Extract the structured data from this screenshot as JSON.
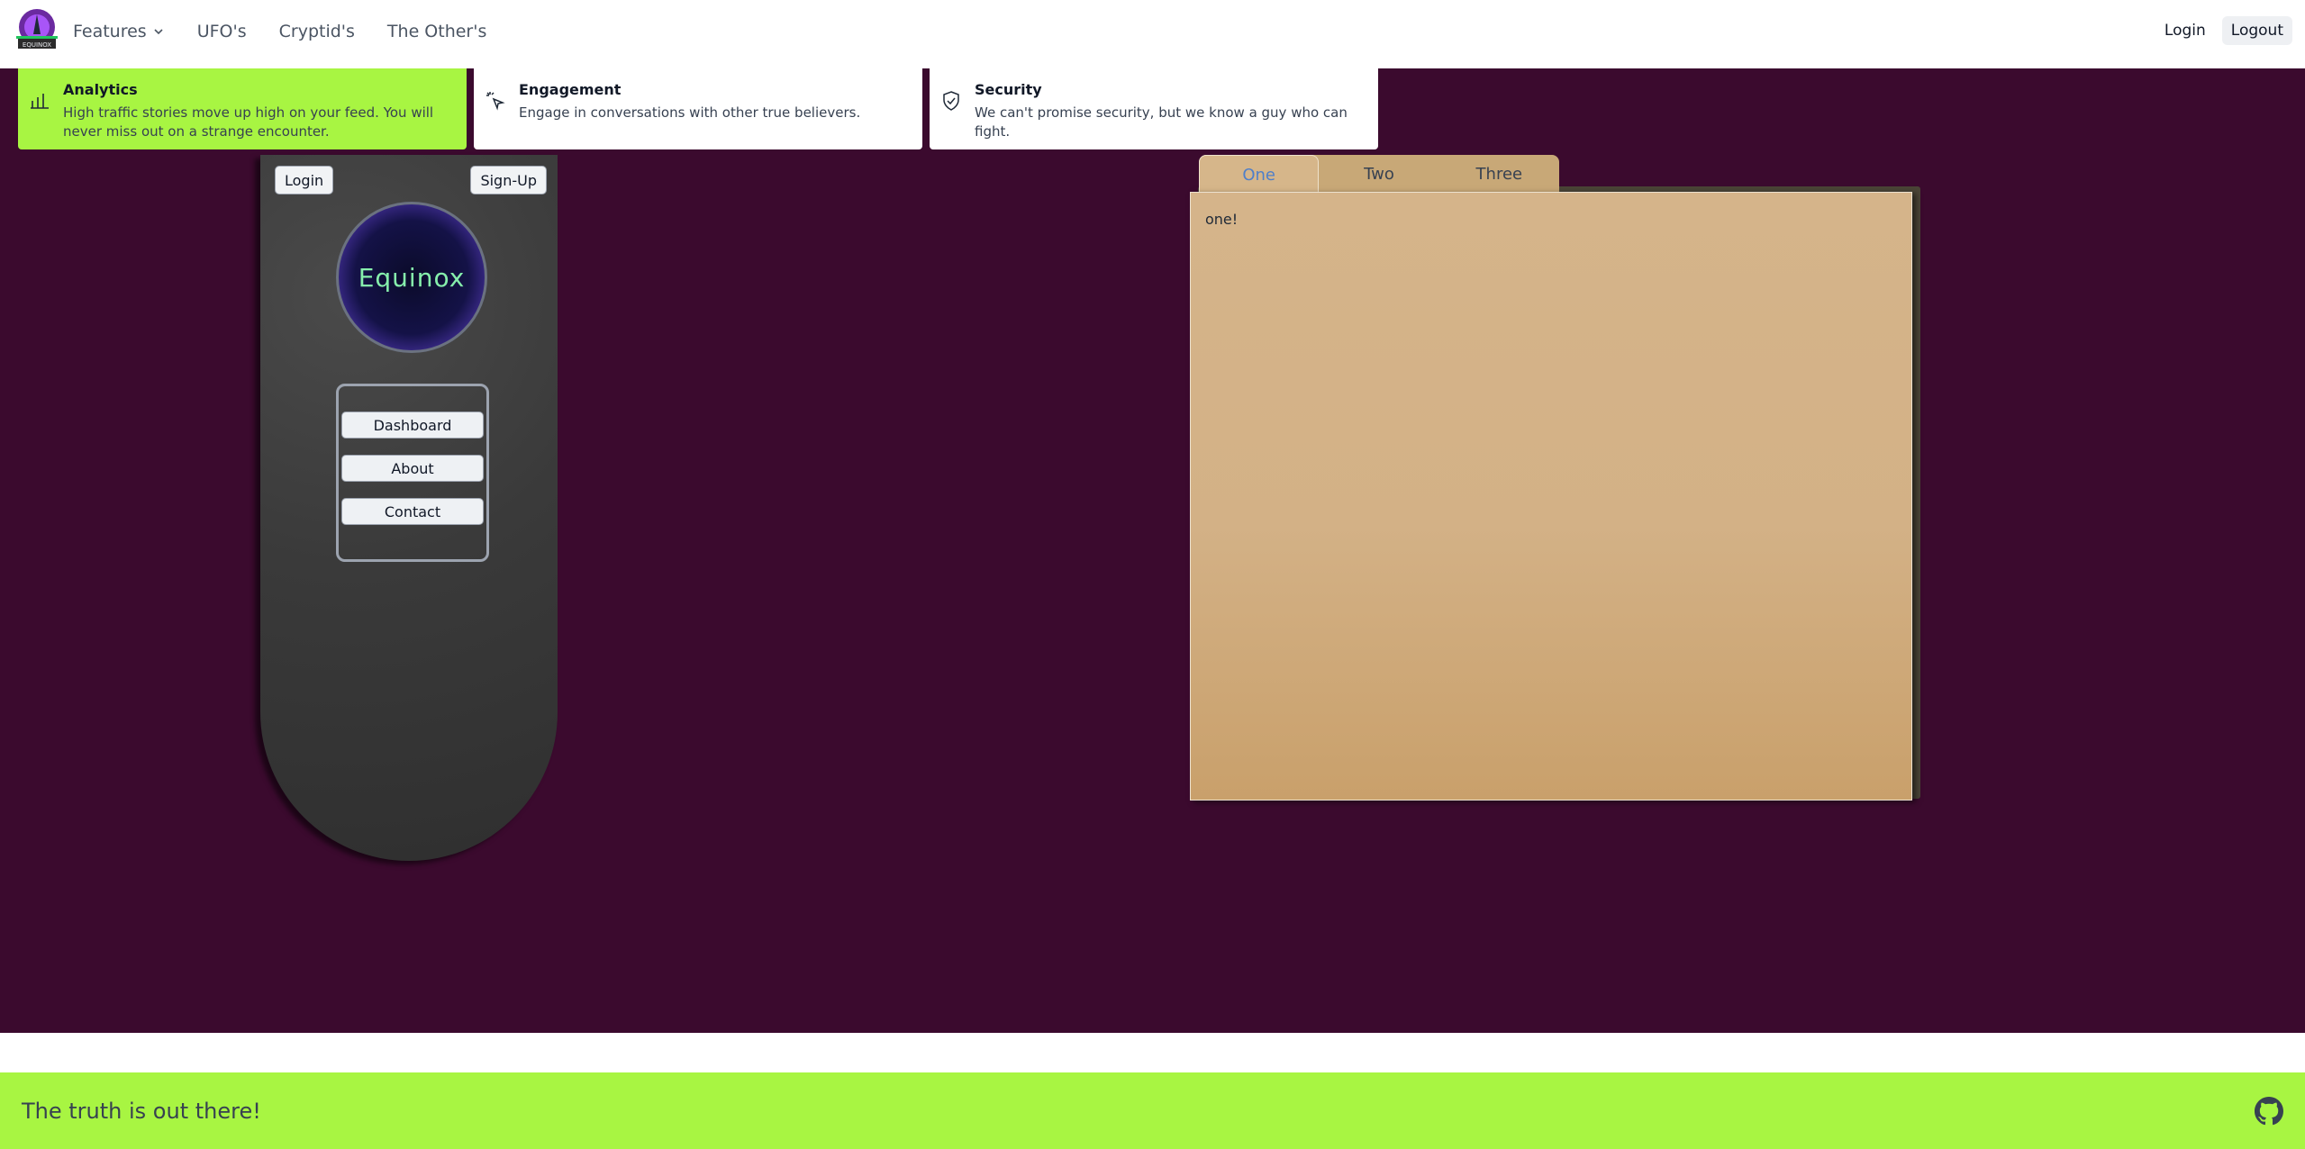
{
  "navbar": {
    "logo_text": "EQUINOX",
    "links": [
      {
        "label": "Features",
        "has_dropdown": true
      },
      {
        "label": "UFO's"
      },
      {
        "label": "Cryptid's"
      },
      {
        "label": "The Other's"
      }
    ],
    "login_label": "Login",
    "logout_label": "Logout"
  },
  "features": [
    {
      "title": "Analytics",
      "description": "High traffic stories move up high on your feed. You will never miss out on a strange encounter.",
      "icon": "bar-chart-icon",
      "active": true
    },
    {
      "title": "Engagement",
      "description": "Engage in conversations with other true believers.",
      "icon": "cursor-click-icon",
      "active": false
    },
    {
      "title": "Security",
      "description": "We can't promise security, but we know a guy who can fight.",
      "icon": "shield-check-icon",
      "active": false
    }
  ],
  "panel": {
    "login_label": "Login",
    "signup_label": "Sign-Up",
    "brand": "Equinox",
    "menu": [
      "Dashboard",
      "About",
      "Contact"
    ]
  },
  "tabs": {
    "items": [
      "One",
      "Two",
      "Three"
    ],
    "active_index": 0,
    "content": "one!"
  },
  "footer": {
    "tagline": "The truth is out there!",
    "icon": "github-icon"
  },
  "colors": {
    "background": "#3b0a2e",
    "accent": "#a8f542",
    "folder": "#d5b48a"
  }
}
